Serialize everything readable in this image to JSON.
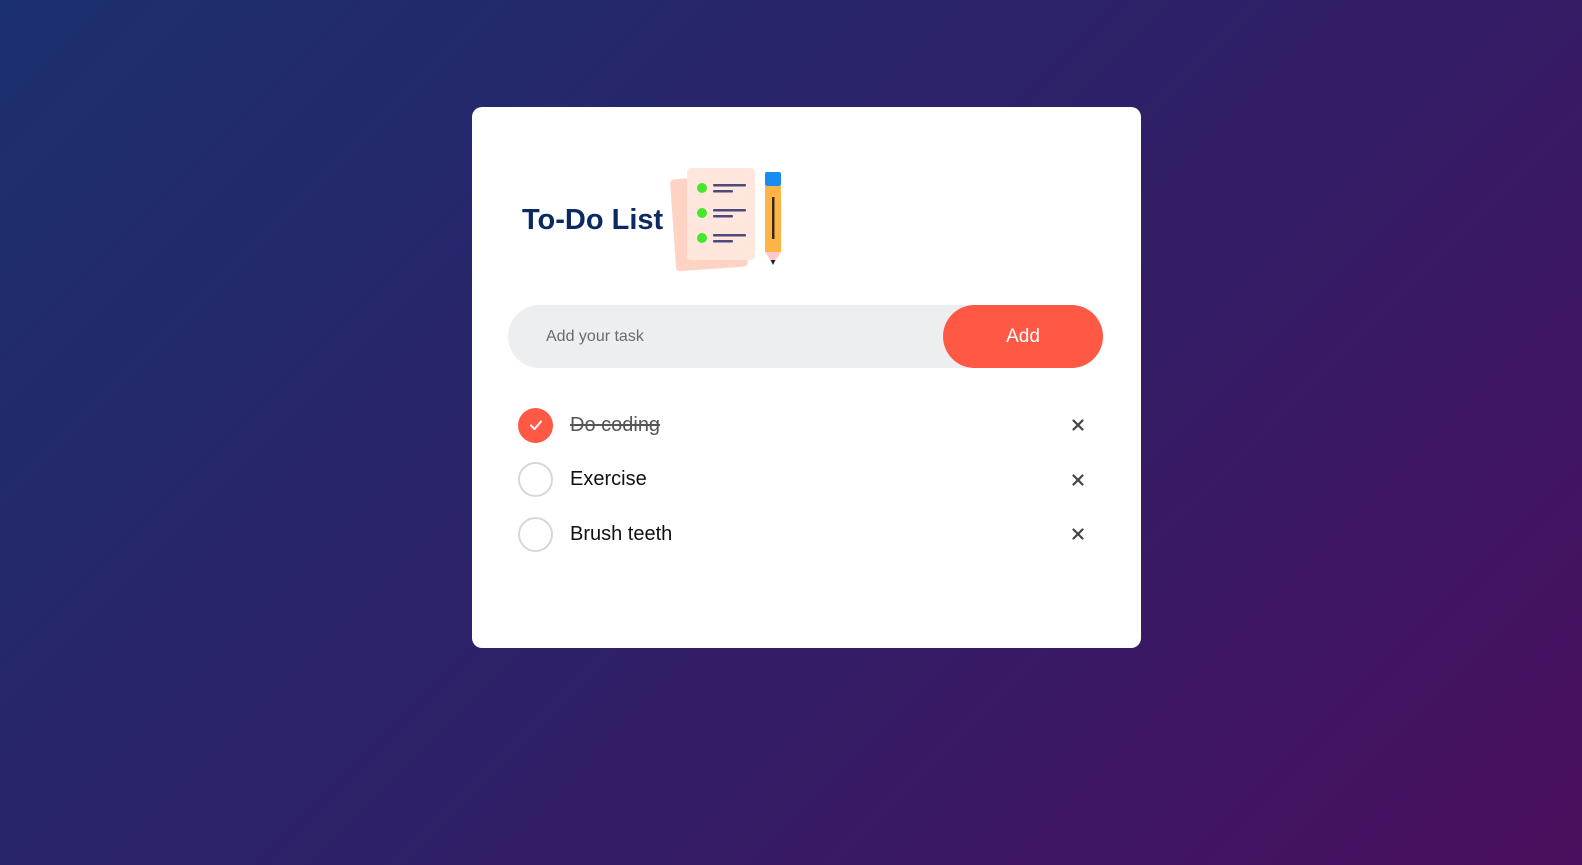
{
  "app": {
    "title": "To-Do List",
    "icon": "checklist-with-pencil-icon"
  },
  "input": {
    "placeholder": "Add your task",
    "value": ""
  },
  "add_button": {
    "label": "Add"
  },
  "tasks": [
    {
      "text": "Do coding",
      "checked": true
    },
    {
      "text": "Exercise",
      "checked": false
    },
    {
      "text": "Brush teeth",
      "checked": false
    }
  ],
  "icons": {
    "checked": "check-icon",
    "delete": "close-icon"
  },
  "colors": {
    "accent": "#ff5945",
    "title": "#0b2a63",
    "background_start": "#1b3070",
    "background_end": "#4a0f5e",
    "input_background": "#eceef0"
  }
}
